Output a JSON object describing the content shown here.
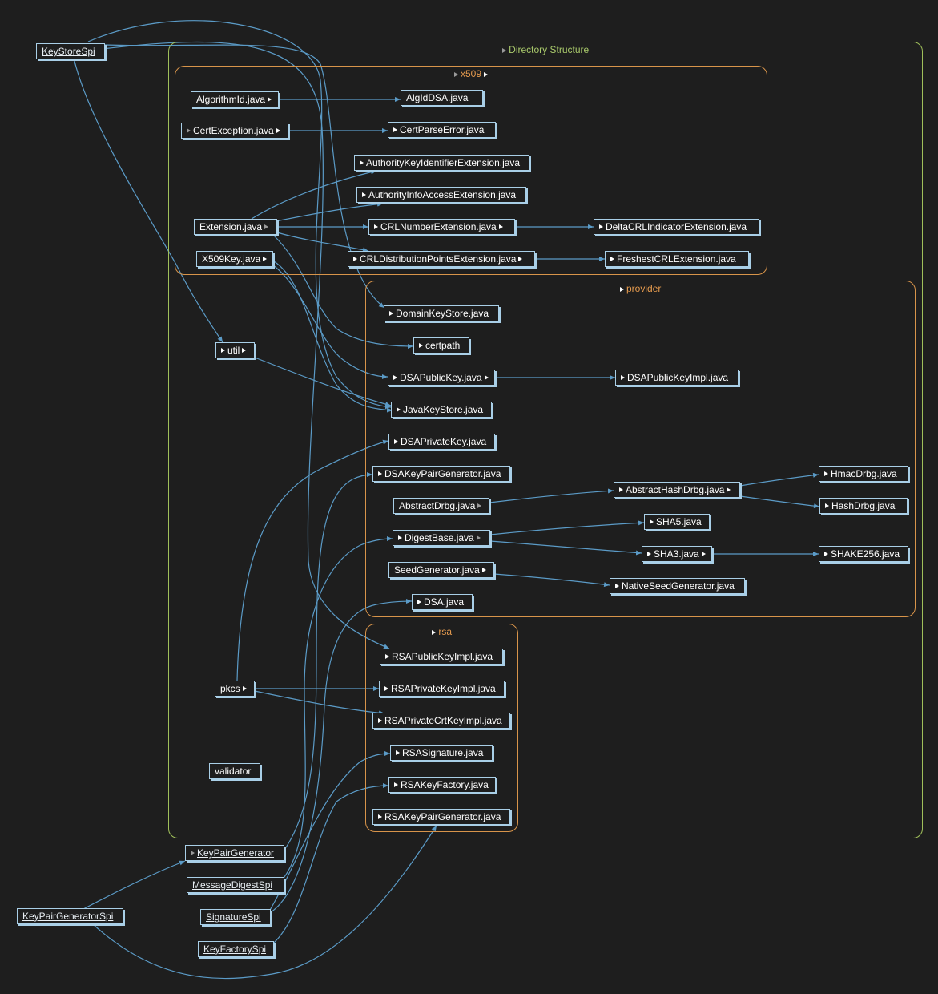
{
  "colors": {
    "background": "#1e1e1e",
    "edge": "#5b9bc7",
    "node_border": "#a9cfe7",
    "group_outer": "#9fbf5a",
    "group_inner": "#d8944a"
  },
  "groups": {
    "directory_structure": "Directory Structure",
    "x509": "x509",
    "provider": "provider",
    "rsa": "rsa"
  },
  "nodes": {
    "keystorespi": "KeyStoreSpi",
    "algorithmid": "AlgorithmId.java",
    "algiddsa": "AlgIdDSA.java",
    "certexception": "CertException.java",
    "certparseerror": "CertParseError.java",
    "authoritykeyid": "AuthorityKeyIdentifierExtension.java",
    "authorityinfo": "AuthorityInfoAccessExtension.java",
    "extension": "Extension.java",
    "crlnumber": "CRLNumberExtension.java",
    "deltacrl": "DeltaCRLIndicatorExtension.java",
    "x509key": "X509Key.java",
    "crldist": "CRLDistributionPointsExtension.java",
    "freshestcrl": "FreshestCRLExtension.java",
    "domainkeystore": "DomainKeyStore.java",
    "certpath": "certpath",
    "util": "util",
    "dsapublickey": "DSAPublicKey.java",
    "dsapublickeyimpl": "DSAPublicKeyImpl.java",
    "javakeystore": "JavaKeyStore.java",
    "dsaprivatekey": "DSAPrivateKey.java",
    "dsakeypairgen": "DSAKeyPairGenerator.java",
    "hmacdrbg": "HmacDrbg.java",
    "abstracthashdrbg": "AbstractHashDrbg.java",
    "abstractdrbg": "AbstractDrbg.java",
    "hashdrbg": "HashDrbg.java",
    "sha5": "SHA5.java",
    "digestbase": "DigestBase.java",
    "sha3": "SHA3.java",
    "shake256": "SHAKE256.java",
    "seedgenerator": "SeedGenerator.java",
    "nativeseedgen": "NativeSeedGenerator.java",
    "dsa": "DSA.java",
    "rsapublickeyimpl": "RSAPublicKeyImpl.java",
    "pkcs": "pkcs",
    "rsaprivatekeyimpl": "RSAPrivateKeyImpl.java",
    "rsaprivatecrt": "RSAPrivateCrtKeyImpl.java",
    "rsasignature": "RSASignature.java",
    "validator": "validator",
    "rsakeyfactory": "RSAKeyFactory.java",
    "rsakeypairgen": "RSAKeyPairGenerator.java",
    "keypairgenerator": "KeyPairGenerator",
    "messagedigestspi": "MessageDigestSpi",
    "keypairgeneratorspi": "KeyPairGeneratorSpi",
    "signaturespi": "SignatureSpi",
    "keyfactoryspi": "KeyFactorySpi"
  }
}
